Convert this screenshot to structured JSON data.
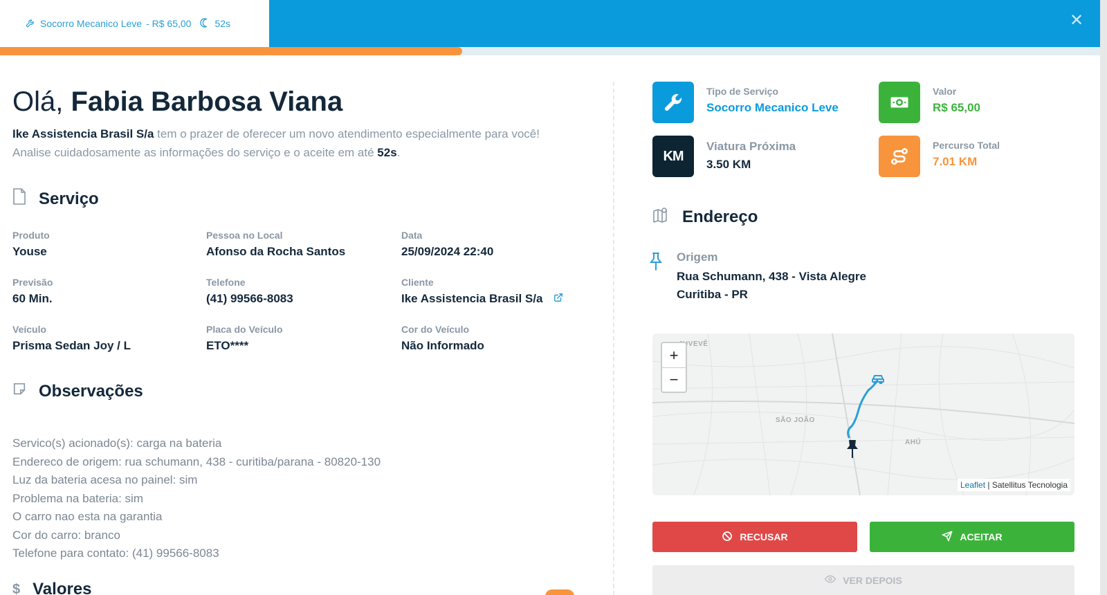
{
  "header": {
    "tab_service": "Socorro Mecanico Leve",
    "tab_value": "- R$ 65,00",
    "tab_timer": "52s",
    "progress_fraction": 0.42
  },
  "greeting": {
    "prefix": "Olá,",
    "name": "Fabia Barbosa Viana"
  },
  "intro": {
    "company": "Ike Assistencia Brasil S/a",
    "line1_rest": " tem o prazer de oferecer um novo atendimento especialmente para você!",
    "line2": "Analise cuidadosamente as informações do serviço e o aceite em até ",
    "timer": "52s",
    "period": "."
  },
  "servico": {
    "title": "Serviço",
    "fields": [
      {
        "label": "Produto",
        "value": "Youse"
      },
      {
        "label": "Pessoa no Local",
        "value": "Afonso da Rocha Santos"
      },
      {
        "label": "Data",
        "value": "25/09/2024 22:40"
      },
      {
        "label": "Previsão",
        "value": "60 Min."
      },
      {
        "label": "Telefone",
        "value": "(41) 99566-8083"
      },
      {
        "label": "Cliente",
        "value": "Ike Assistencia Brasil S/a"
      },
      {
        "label": "Veículo",
        "value": "Prisma Sedan Joy / L"
      },
      {
        "label": "Placa do Veículo",
        "value": "ETO****"
      },
      {
        "label": "Cor do Veículo",
        "value": "Não Informado"
      }
    ]
  },
  "observacoes": {
    "title": "Observações",
    "lines": [
      "Servico(s) acionado(s): carga na bateria",
      "Endereco de origem: rua schumann, 438 - curitiba/parana - 80820-130",
      "Luz da bateria acesa no painel: sim",
      "Problema na bateria: sim",
      "O carro nao esta na garantia",
      "Cor do carro: branco",
      "Telefone para contato: (41) 99566-8083"
    ]
  },
  "valores": {
    "title": "Valores"
  },
  "cards": [
    {
      "label": "Tipo de Serviço",
      "value": "Socorro Mecanico Leve",
      "color": "#0a9bdc",
      "icon": "wrench-icon"
    },
    {
      "label": "Valor",
      "value": "R$ 65,00",
      "color": "#3bb33b",
      "icon": "money-icon"
    },
    {
      "label": "Viatura Próxima",
      "value": "3.50 KM",
      "color": "#0d2533",
      "icon": "km-icon",
      "icon_text": "KM"
    },
    {
      "label": "Percurso Total",
      "value": "7.01 KM",
      "color": "#f8943c",
      "icon": "route-icon"
    }
  ],
  "endereco": {
    "title": "Endereço",
    "origin_label": "Origem",
    "line1": "Rua Schumann, 438 - Vista Alegre",
    "line2": "Curitiba - PR"
  },
  "map": {
    "zoom_in": "+",
    "zoom_out": "−",
    "attribution_link": "Leaflet",
    "attribution_text": " | Satellitus Tecnologia",
    "labels": [
      "JUVEVÊ",
      "SÃO JOÃO",
      "AHÚ"
    ]
  },
  "actions": {
    "refuse": "RECUSAR",
    "accept": "ACEITAR",
    "later": "VER DEPOIS",
    "refuse_color": "#e04848",
    "accept_color": "#3bb33b"
  }
}
